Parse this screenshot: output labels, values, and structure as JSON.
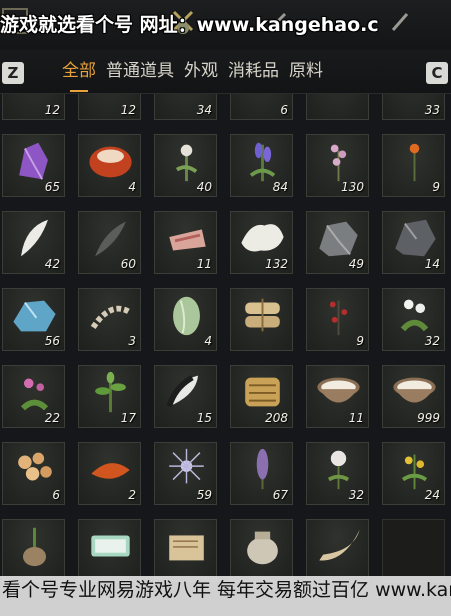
{
  "watermark_top": "游戏就选看个号 网址：www.kangehao.c",
  "tabs": {
    "hotkey_left": "Z",
    "hotkey_right": "C",
    "items": [
      {
        "label": "全部",
        "active": true
      },
      {
        "label": "普通道具",
        "active": false
      },
      {
        "label": "外观",
        "active": false
      },
      {
        "label": "消耗品",
        "active": false
      },
      {
        "label": "原料",
        "active": false
      }
    ]
  },
  "colors": {
    "accent": "#e7a23b",
    "cell_border": "#3b3d38",
    "background": "#16171a"
  },
  "items": [
    {
      "icon": "pebble-icon",
      "qty": "12"
    },
    {
      "icon": "cloth-icon",
      "qty": "12"
    },
    {
      "icon": "fur-icon",
      "qty": "34"
    },
    {
      "icon": "fish-icon",
      "qty": "6"
    },
    {
      "icon": "herb-icon",
      "qty": ""
    },
    {
      "icon": "ore-icon",
      "qty": "33"
    },
    {
      "icon": "amethyst-crystal-icon",
      "qty": "65"
    },
    {
      "icon": "red-gem-icon",
      "qty": "4"
    },
    {
      "icon": "white-flower-herb-icon",
      "qty": "40"
    },
    {
      "icon": "purple-lavender-icon",
      "qty": "84"
    },
    {
      "icon": "pink-blossom-herb-icon",
      "qty": "130"
    },
    {
      "icon": "orange-flower-icon",
      "qty": "9"
    },
    {
      "icon": "white-feather-icon",
      "qty": "42"
    },
    {
      "icon": "dark-feather-icon",
      "qty": "60"
    },
    {
      "icon": "raw-meat-icon",
      "qty": "11"
    },
    {
      "icon": "white-pelt-icon",
      "qty": "132"
    },
    {
      "icon": "grey-ore-icon",
      "qty": "49"
    },
    {
      "icon": "dark-ore-icon",
      "qty": "14"
    },
    {
      "icon": "blue-ore-icon",
      "qty": "56"
    },
    {
      "icon": "bone-spine-icon",
      "qty": "3"
    },
    {
      "icon": "green-melon-icon",
      "qty": "4"
    },
    {
      "icon": "bundle-sack-icon",
      "qty": ""
    },
    {
      "icon": "red-berry-branch-icon",
      "qty": "9"
    },
    {
      "icon": "white-flower-bush-icon",
      "qty": "32"
    },
    {
      "icon": "pink-flower-herb-icon",
      "qty": "22"
    },
    {
      "icon": "green-leaf-herb-icon",
      "qty": "17"
    },
    {
      "icon": "black-white-feather-icon",
      "qty": "15"
    },
    {
      "icon": "golden-scroll-icon",
      "qty": "208"
    },
    {
      "icon": "milk-bowl-icon",
      "qty": "11"
    },
    {
      "icon": "milk-bowl-icon",
      "qty": "999"
    },
    {
      "icon": "rice-cakes-icon",
      "qty": "6"
    },
    {
      "icon": "red-brick-icon",
      "qty": "2"
    },
    {
      "icon": "spiky-flower-icon",
      "qty": "59"
    },
    {
      "icon": "purple-spike-herb-icon",
      "qty": "67"
    },
    {
      "icon": "white-bloom-icon",
      "qty": "32"
    },
    {
      "icon": "yellow-flower-herb-icon",
      "qty": "24"
    },
    {
      "icon": "root-herb-icon",
      "qty": ""
    },
    {
      "icon": "jade-box-icon",
      "qty": ""
    },
    {
      "icon": "paper-scroll-icon",
      "qty": ""
    },
    {
      "icon": "pottery-jar-icon",
      "qty": ""
    },
    {
      "icon": "horn-icon",
      "qty": ""
    },
    {
      "icon": "empty-slot",
      "qty": ""
    }
  ],
  "watermark_bottom": "看个号专业网易游戏八年 每年交易额过百亿 www.kangehao.c"
}
